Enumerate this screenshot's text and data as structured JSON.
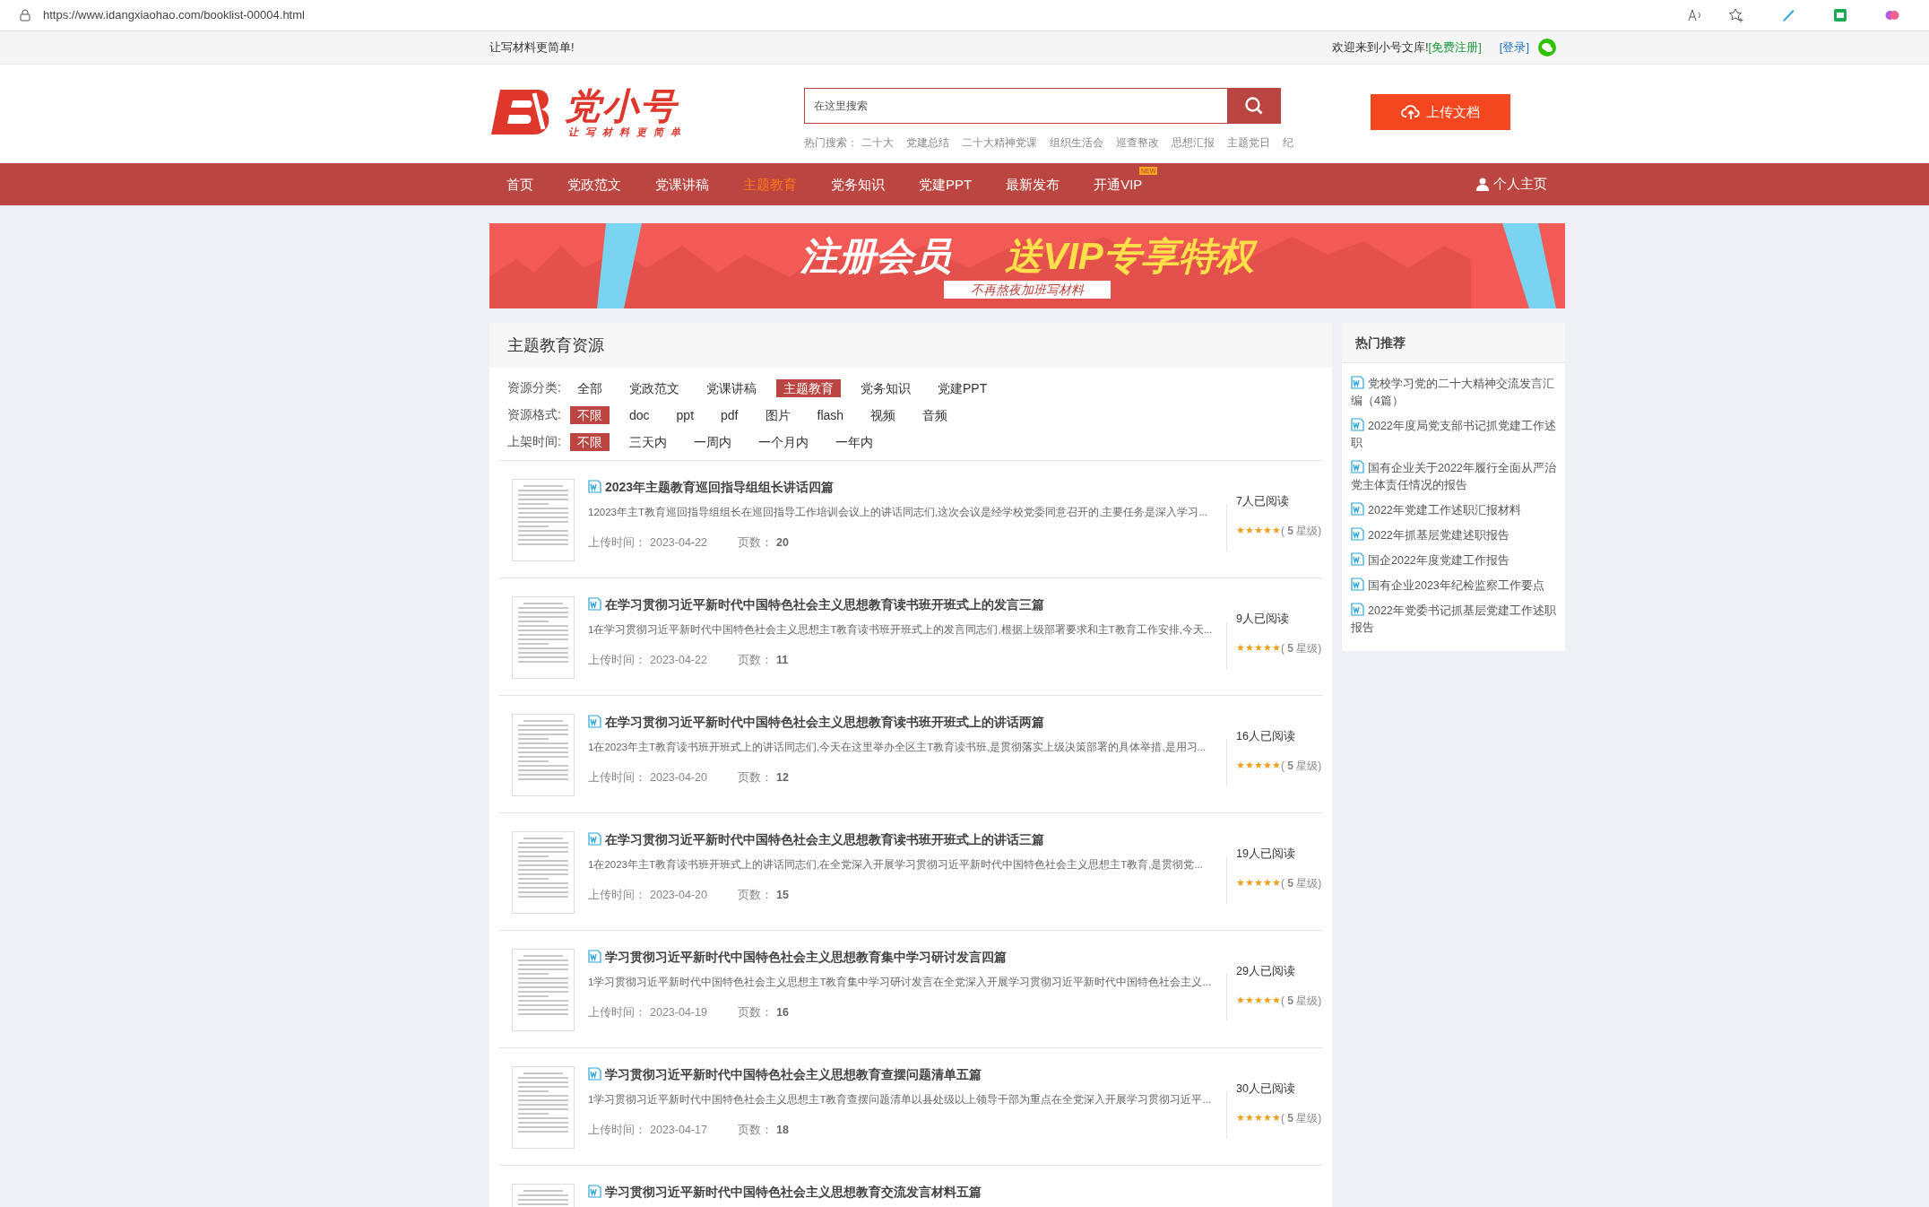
{
  "browser": {
    "url": "https://www.idangxiaohao.com/booklist-00004.html"
  },
  "topbar": {
    "slogan": "让写材料更简单!",
    "welcome": "欢迎来到小号文库!",
    "register": "[免费注册]",
    "login": "[登录]"
  },
  "header": {
    "logo": {
      "name": "党小号",
      "tagline": "让写材料更简单"
    },
    "search": {
      "placeholder": "在这里搜索"
    },
    "hot_label": "热门搜索：",
    "hot_terms": [
      "二十大",
      "党建总结",
      "二十大精神党课",
      "组织生活会",
      "巡查整改",
      "思想汇报",
      "主题党日",
      "纪"
    ],
    "upload": "上传文档"
  },
  "nav": {
    "items": [
      {
        "label": "首页",
        "selected": false
      },
      {
        "label": "党政范文",
        "selected": false
      },
      {
        "label": "党课讲稿",
        "selected": false
      },
      {
        "label": "主题教育",
        "selected": true
      },
      {
        "label": "党务知识",
        "selected": false
      },
      {
        "label": "党建PPT",
        "selected": false
      },
      {
        "label": "最新发布",
        "selected": false
      },
      {
        "label": "开通VIP",
        "selected": false,
        "badge": "NEW"
      }
    ],
    "profile": "个人主页"
  },
  "banner": {
    "left": "注册会员",
    "right": "送VIP专享特权",
    "sub": "不再熬夜加班写材料"
  },
  "main": {
    "title": "主题教育资源",
    "filters": [
      {
        "label": "资源分类:",
        "options": [
          {
            "label": "全部",
            "selected": false
          },
          {
            "label": "党政范文",
            "selected": false
          },
          {
            "label": "党课讲稿",
            "selected": false
          },
          {
            "label": "主题教育",
            "selected": true
          },
          {
            "label": "党务知识",
            "selected": false
          },
          {
            "label": "党建PPT",
            "selected": false
          }
        ]
      },
      {
        "label": "资源格式:",
        "options": [
          {
            "label": "不限",
            "selected": true
          },
          {
            "label": "doc",
            "selected": false
          },
          {
            "label": "ppt",
            "selected": false
          },
          {
            "label": "pdf",
            "selected": false
          },
          {
            "label": "图片",
            "selected": false
          },
          {
            "label": "flash",
            "selected": false
          },
          {
            "label": "视频",
            "selected": false
          },
          {
            "label": "音频",
            "selected": false
          }
        ]
      },
      {
        "label": "上架时间:",
        "options": [
          {
            "label": "不限",
            "selected": true
          },
          {
            "label": "三天内",
            "selected": false
          },
          {
            "label": "一周内",
            "selected": false
          },
          {
            "label": "一个月内",
            "selected": false
          },
          {
            "label": "一年内",
            "selected": false
          }
        ]
      }
    ],
    "docs": [
      {
        "title": "2023年主题教育巡回指导组组长讲话四篇",
        "summary": "12023年主T教育巡回指导组组长在巡回指导工作培训会议上的讲话同志们,这次会议是经学校党委同意召开的,主要任务是深入学习...",
        "date_label": "上传时间：",
        "date": "2023-04-22",
        "pages_label": "页数：",
        "pages": "20",
        "reads": "7人已阅读",
        "stars": 5,
        "rating": "( **5** 星级)"
      },
      {
        "title": "在学习贯彻习近平新时代中国特色社会主义思想教育读书班开班式上的发言三篇",
        "summary": "1在学习贯彻习近平新时代中国特色社会主义思想主T教育读书班开班式上的发言同志们,根据上级部署要求和主T教育工作安排,今天...",
        "date_label": "上传时间：",
        "date": "2023-04-22",
        "pages_label": "页数：",
        "pages": "11",
        "reads": "9人已阅读",
        "stars": 5,
        "rating": "( **5** 星级)"
      },
      {
        "title": "在学习贯彻习近平新时代中国特色社会主义思想教育读书班开班式上的讲话两篇",
        "summary": "1在2023年主T教育读书班开班式上的讲话同志们,今天在这里举办全区主T教育读书班,是贯彻落实上级决策部署的具体举措,是用习...",
        "date_label": "上传时间：",
        "date": "2023-04-20",
        "pages_label": "页数：",
        "pages": "12",
        "reads": "16人已阅读",
        "stars": 5,
        "rating": "( **5** 星级)"
      },
      {
        "title": "在学习贯彻习近平新时代中国特色社会主义思想教育读书班开班式上的讲话三篇",
        "summary": "1在2023年主T教育读书班开班式上的讲话同志们,在全党深入开展学习贯彻习近平新时代中国特色社会主义思想主T教育,是贯彻党...",
        "date_label": "上传时间：",
        "date": "2023-04-20",
        "pages_label": "页数：",
        "pages": "15",
        "reads": "19人已阅读",
        "stars": 5,
        "rating": "( **5** 星级)"
      },
      {
        "title": "学习贯彻习近平新时代中国特色社会主义思想教育集中学习研讨发言四篇",
        "summary": "1学习贯彻习近平新时代中国特色社会主义思想主T教育集中学习研讨发言在全党深入开展学习贯彻习近平新时代中国特色社会主义...",
        "date_label": "上传时间：",
        "date": "2023-04-19",
        "pages_label": "页数：",
        "pages": "16",
        "reads": "29人已阅读",
        "stars": 5,
        "rating": "( **5** 星级)"
      },
      {
        "title": "学习贯彻习近平新时代中国特色社会主义思想教育查摆问题清单五篇",
        "summary": "1学习贯彻习近平新时代中国特色社会主义思想主T教育查摆问题清单以县处级以上领导干部为重点在全党深入开展学习贯彻习近平...",
        "date_label": "上传时间：",
        "date": "2023-04-17",
        "pages_label": "页数：",
        "pages": "18",
        "reads": "30人已阅读",
        "stars": 5,
        "rating": "( **5** 星级)"
      },
      {
        "title": "学习贯彻习近平新时代中国特色社会主义思想教育交流发言材料五篇"
      }
    ]
  },
  "sidebar": {
    "title": "热门推荐",
    "items": [
      "党校学习党的二十大精神交流发言汇编（4篇）",
      "2022年度局党支部书记抓党建工作述职",
      "国有企业关于2022年履行全面从严治党主体责任情况的报告",
      "2022年党建工作述职汇报材料",
      "2022年抓基层党建述职报告",
      "国企2022年度党建工作报告",
      "国有企业2023年纪检监察工作要点",
      "2022年党委书记抓基层党建工作述职报告"
    ]
  }
}
